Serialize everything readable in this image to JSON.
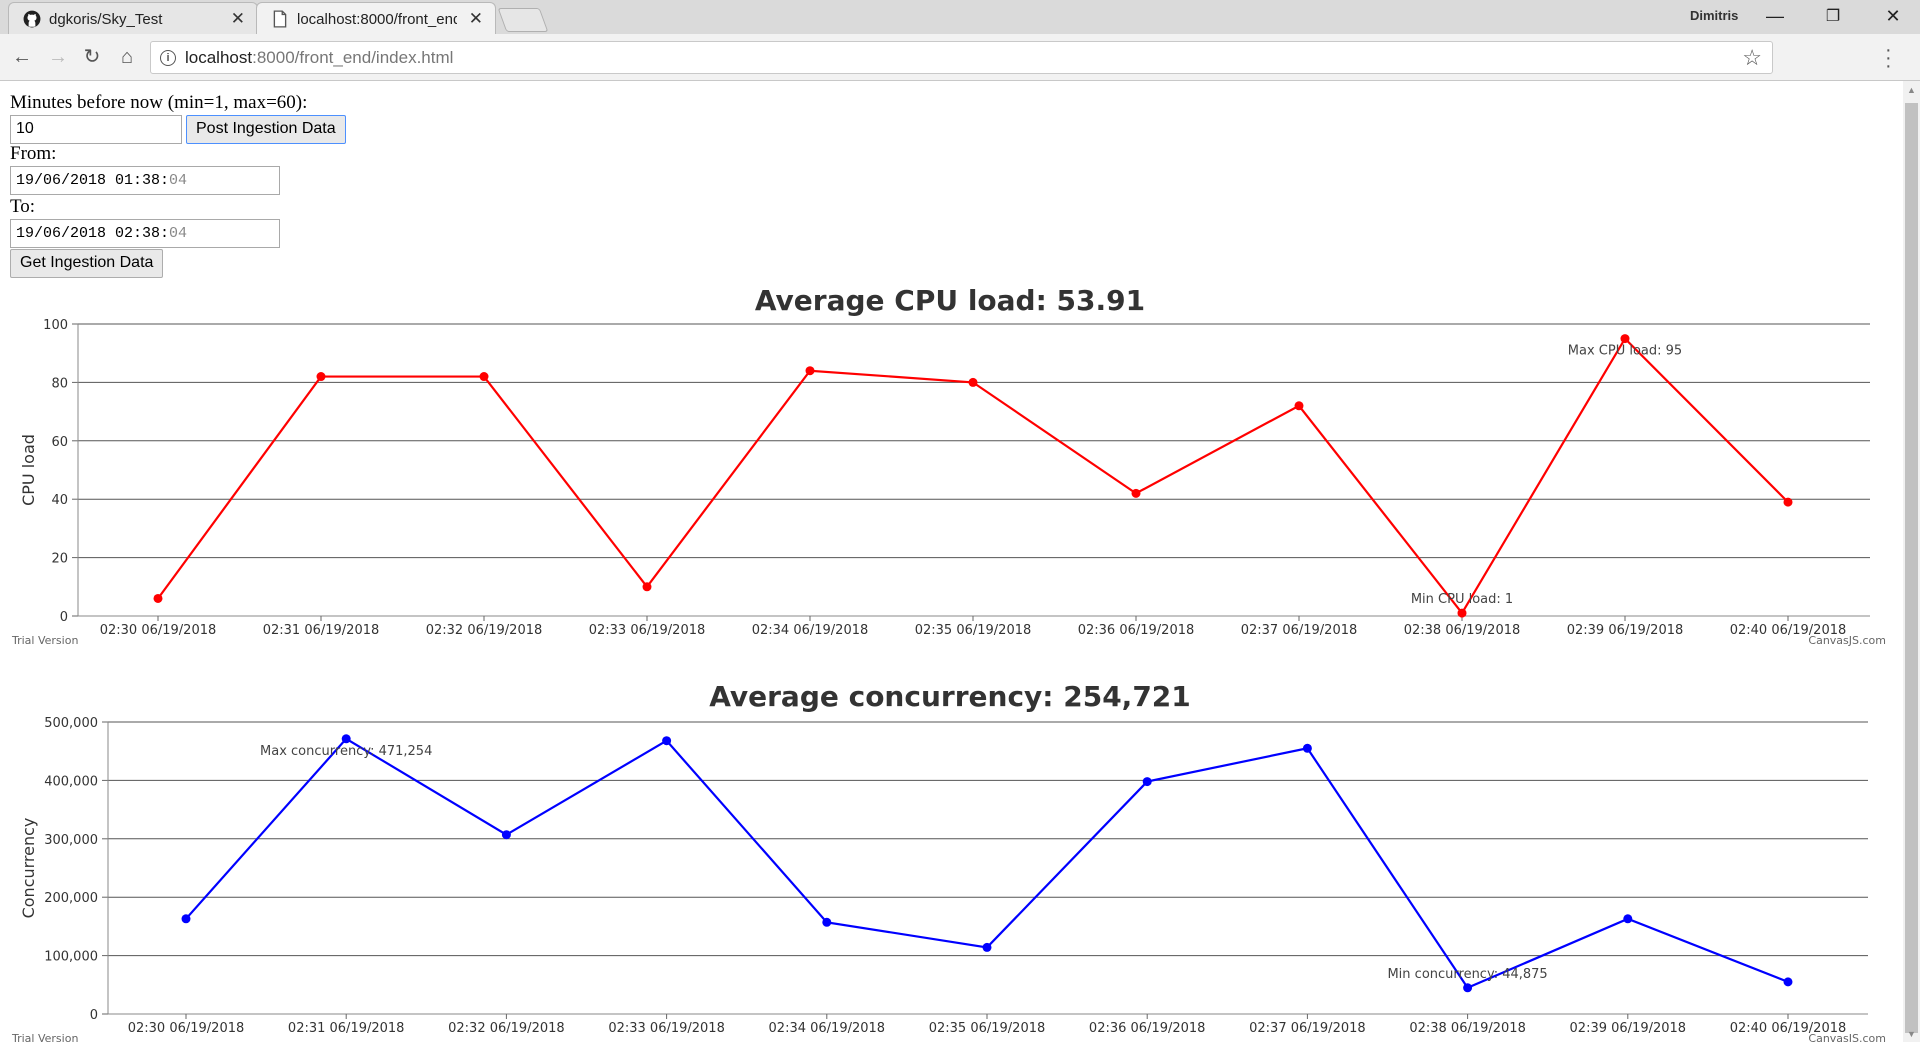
{
  "browser": {
    "tabs": [
      {
        "title": "dgkoris/Sky_Test",
        "icon": "github-icon",
        "active": false
      },
      {
        "title": "localhost:8000/front_end",
        "icon": "page-icon",
        "active": true
      }
    ],
    "profile_name": "Dimitris",
    "url_host": "localhost",
    "url_path": ":8000/front_end/index.html"
  },
  "form": {
    "minutes_label": "Minutes before now (min=1, max=60):",
    "minutes_value": "10",
    "post_button": "Post Ingestion Data",
    "from_label": "From:",
    "from_main": "19/06/2018 01:38:",
    "from_secs": "04",
    "to_label": "To:",
    "to_main": "19/06/2018 02:38:",
    "to_secs": "04",
    "get_button": "Get Ingestion Data"
  },
  "chart_data": [
    {
      "type": "line",
      "title": "Average CPU load: 53.91",
      "ylabel": "CPU load",
      "xlabel": "",
      "categories": [
        "02:30 06/19/2018",
        "02:31 06/19/2018",
        "02:32 06/19/2018",
        "02:33 06/19/2018",
        "02:34 06/19/2018",
        "02:35 06/19/2018",
        "02:36 06/19/2018",
        "02:37 06/19/2018",
        "02:38 06/19/2018",
        "02:39 06/19/2018",
        "02:40 06/19/2018"
      ],
      "values": [
        6,
        82,
        82,
        10,
        84,
        80,
        42,
        72,
        1,
        95,
        39
      ],
      "ylim": [
        0,
        100
      ],
      "yticks": [
        0,
        20,
        40,
        60,
        80,
        100
      ],
      "ytick_labels": [
        "0",
        "20",
        "40",
        "60",
        "80",
        "100"
      ],
      "color": "#ff0000",
      "grid": true,
      "annotations": [
        {
          "index": 9,
          "text": "Max CPU load: 95"
        },
        {
          "index": 8,
          "text": "Min CPU load: 1"
        }
      ],
      "watermark_left": "Trial Version",
      "watermark_right": "CanvasJS.com"
    },
    {
      "type": "line",
      "title": "Average concurrency: 254,721",
      "ylabel": "Concurrency",
      "xlabel": "",
      "categories": [
        "02:30 06/19/2018",
        "02:31 06/19/2018",
        "02:32 06/19/2018",
        "02:33 06/19/2018",
        "02:34 06/19/2018",
        "02:35 06/19/2018",
        "02:36 06/19/2018",
        "02:37 06/19/2018",
        "02:38 06/19/2018",
        "02:39 06/19/2018",
        "02:40 06/19/2018"
      ],
      "values": [
        163000,
        471254,
        307000,
        468000,
        157000,
        114000,
        398000,
        455000,
        44875,
        163000,
        55000
      ],
      "ylim": [
        0,
        500000
      ],
      "yticks": [
        0,
        100000,
        200000,
        300000,
        400000,
        500000
      ],
      "ytick_labels": [
        "0",
        "100,000",
        "200,000",
        "300,000",
        "400,000",
        "500,000"
      ],
      "color": "#0000ff",
      "grid": true,
      "annotations": [
        {
          "index": 1,
          "text": "Max concurrency: 471,254"
        },
        {
          "index": 8,
          "text": "Min concurrency: 44,875"
        }
      ],
      "watermark_left": "Trial Version",
      "watermark_right": "CanvasJS.com"
    }
  ]
}
